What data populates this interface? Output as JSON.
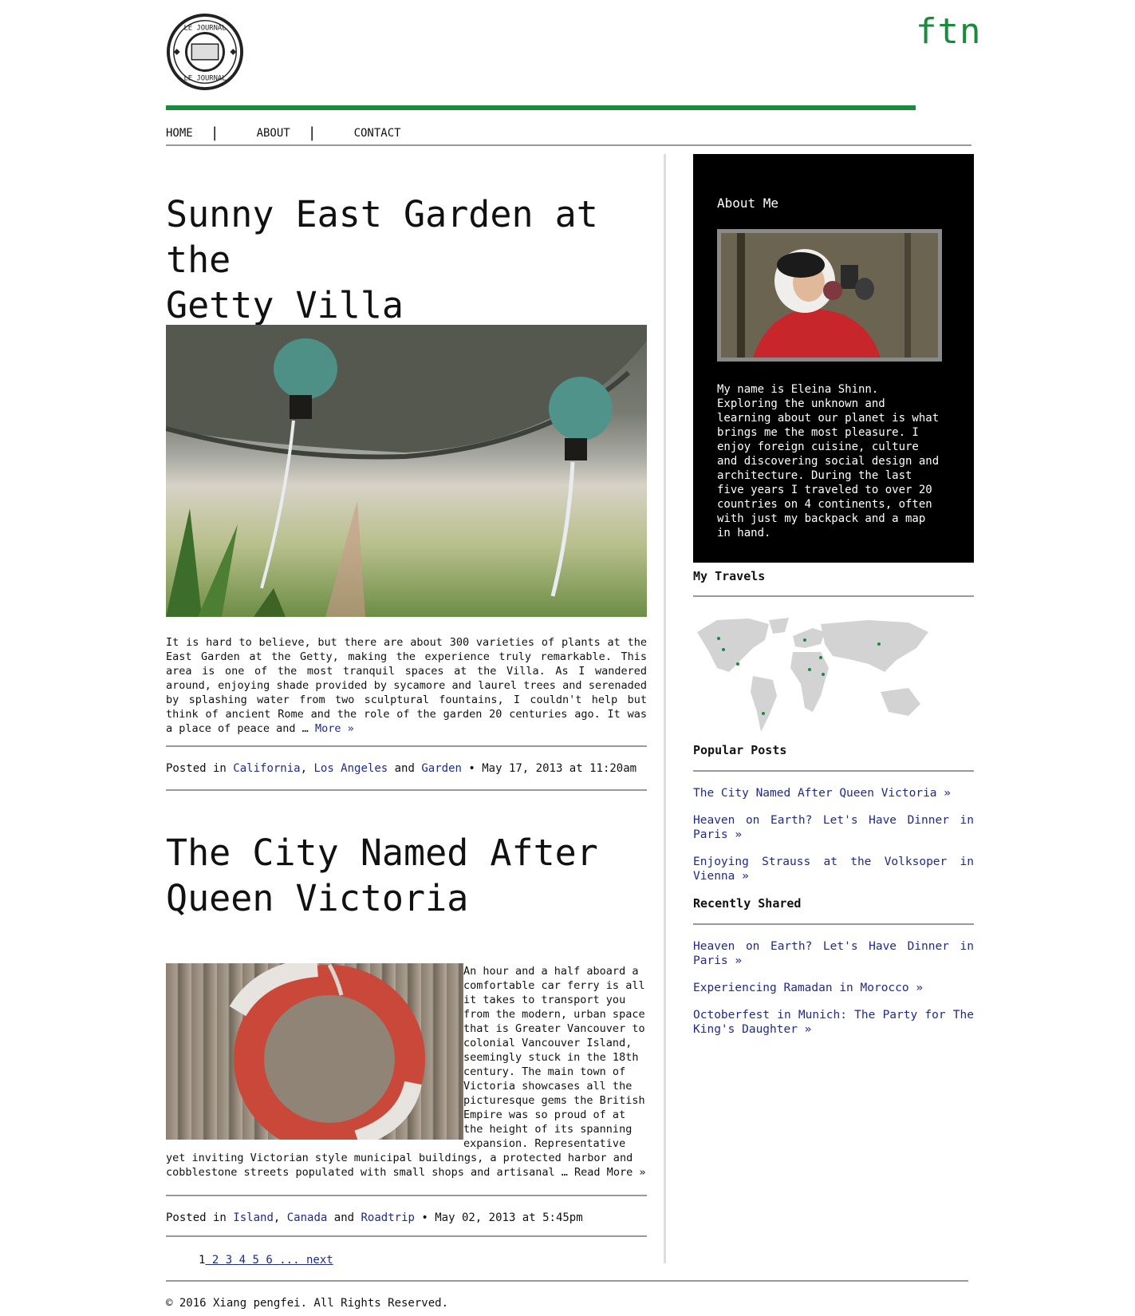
{
  "header": {
    "brand": "ftn",
    "logo_text": "LE JOURNAL"
  },
  "nav": {
    "items": [
      {
        "label": "HOME"
      },
      {
        "label": "ABOUT"
      },
      {
        "label": "CONTACT"
      }
    ],
    "separator": "|"
  },
  "posts": [
    {
      "title_line1": "Sunny East Garden at the",
      "title_line2": "Getty Villa",
      "excerpt": "It is hard to believe, but there are about 300 varieties of plants at the East Garden at the Getty, making the experience truly remarkable. This area is one of the most tranquil spaces at the Villa. As I wandered around, enjoying shade provided by sycamore and laurel trees and serenaded by splashing water from two sculptural fountains, I couldn't help but think of ancient Rome and the role of the garden 20 centuries ago. It was a place of peace and … ",
      "more_label": "More »",
      "posted_in_label": "Posted in",
      "categories": [
        "California",
        "Los Angeles",
        "Garden"
      ],
      "comma": ",",
      "and_label": "and",
      "date_text": "• May 17, 2013 at 11:20am"
    },
    {
      "title_line1": "The City Named After",
      "title_line2": "Queen Victoria",
      "excerpt": "An hour and a half aboard a comfortable car ferry is all it takes to transport you from the modern, urban space that is Greater Vancouver to colonial Vancouver Island, seemingly stuck in the 18th century. The main town of Victoria showcases all the picturesque gems the British Empire was so proud of at the height of its spanning expansion. Representative yet inviting Victorian style municipal buildings, a protected harbor and cobblestone streets populated with small shops and artisanal … ",
      "more_label": "Read More »",
      "posted_in_label": "Posted in",
      "categories": [
        "Island",
        "Canada",
        "Roadtrip"
      ],
      "comma": ",",
      "and_label": "and",
      "date_text": "• May 02, 2013 at 5:45pm"
    }
  ],
  "pagination": {
    "current": "1",
    "pages": [
      "2",
      "3",
      "4",
      "5",
      "6"
    ],
    "ellipsis": "...",
    "next": "next"
  },
  "sidebar": {
    "about_title": "About Me",
    "about_text": "My name is Eleina Shinn. Exploring the unknown and learning about our planet is what brings me the most pleasure. I enjoy foreign cuisine, culture and discovering social design and architecture. During the last five years I traveled to over 20 countries on 4 continents, often with just my backpack and a map in hand.",
    "travels_title": "My Travels",
    "popular_title": "Popular Posts",
    "popular": [
      "The City Named After Queen Victoria »",
      "Heaven on Earth? Let's Have Dinner in Paris »",
      "Enjoying Strauss at the Volksoper in Vienna »"
    ],
    "shared_title": "Recently Shared",
    "shared": [
      "Heaven on Earth? Let's Have Dinner in Paris »",
      "Experiencing Ramadan in Morocco »",
      "Octoberfest in Munich: The Party for The King's Daughter »"
    ]
  },
  "footer": {
    "copyright": "© 2016 Xiang pengfei. All Rights Reserved."
  },
  "colors": {
    "accent": "#1a8a3c",
    "link": "#1f2a8a",
    "rule": "#999999"
  }
}
